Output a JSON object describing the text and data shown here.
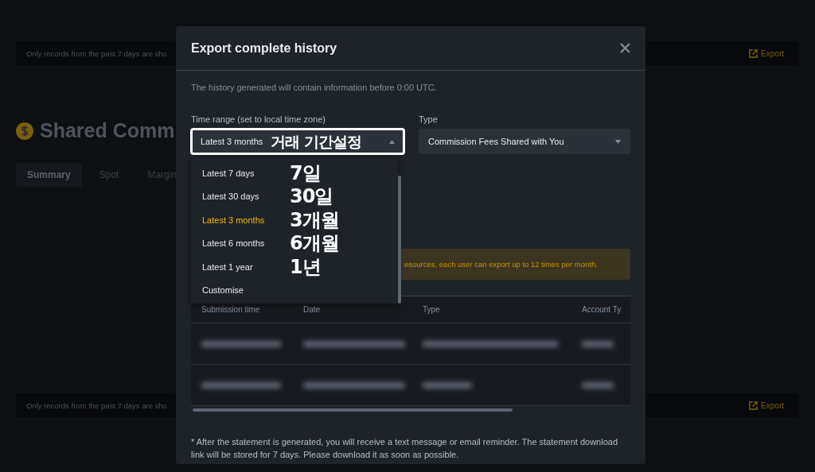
{
  "background": {
    "notices": [
      {
        "text": "Only records from the past 7 days are sho",
        "action": "Export"
      },
      {
        "text": "Only records from the past 7 days are sho",
        "action": "Export"
      }
    ],
    "title": "Shared Comm",
    "tabs": [
      {
        "label": "Summary",
        "selected": true
      },
      {
        "label": "Spot",
        "selected": false
      },
      {
        "label": "Margin",
        "selected": false
      }
    ]
  },
  "dialog": {
    "title": "Export complete history",
    "description": "The history generated will contain information before 0:00 UTC.",
    "time_range": {
      "label": "Time range (set to local time zone)",
      "value": "Latest 3 months",
      "annotation": "거래 기간설정",
      "expanded": true,
      "options": [
        {
          "label": "Latest 7 days",
          "selected": false,
          "annotation": "7일"
        },
        {
          "label": "Latest 30 days",
          "selected": false,
          "annotation": "30일"
        },
        {
          "label": "Latest 3 months",
          "selected": true,
          "annotation": "3개월"
        },
        {
          "label": "Latest 6 months",
          "selected": false,
          "annotation": "6개월"
        },
        {
          "label": "Latest 1 year",
          "selected": false,
          "annotation": "1년"
        },
        {
          "label": "Customise",
          "selected": false
        }
      ]
    },
    "type": {
      "label": "Type",
      "value": "Commission Fees Shared with You"
    },
    "notice": "esources, each user can export up to 12 times per month.",
    "table": {
      "columns": [
        "Submission time",
        "Date",
        "Type",
        "Account Ty"
      ],
      "rows": [
        {
          "blurred": true
        },
        {
          "blurred": true
        }
      ]
    },
    "footnote": "* After the statement is generated, you will receive a text message or email reminder. The statement download link will be stored for 7 days. Please download it as soon as possible."
  }
}
